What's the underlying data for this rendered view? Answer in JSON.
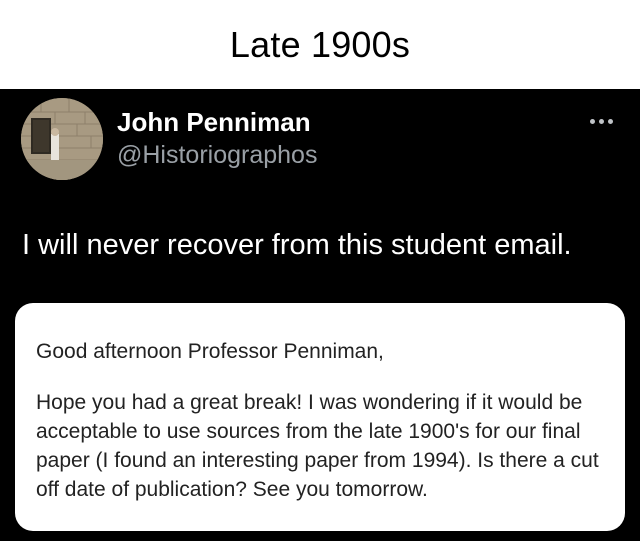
{
  "caption": "Late 1900s",
  "post": {
    "author": {
      "name": "John Penniman",
      "handle": "@Historiographos",
      "avatar_icon": "profile-photo"
    },
    "more_icon": "more-horizontal-icon",
    "text": "I will never recover from this student email.",
    "email": {
      "greeting": "Good afternoon Professor Penniman,",
      "body": "Hope you had a great break! I was wondering if it would be acceptable to use sources from the late 1900's for our final paper (I found an interesting paper from 1994). Is there a cut off date of publication? See you tomorrow."
    }
  },
  "colors": {
    "post_background": "#000000",
    "handle_gray": "#9aa0a6",
    "card_background": "#ffffff"
  }
}
